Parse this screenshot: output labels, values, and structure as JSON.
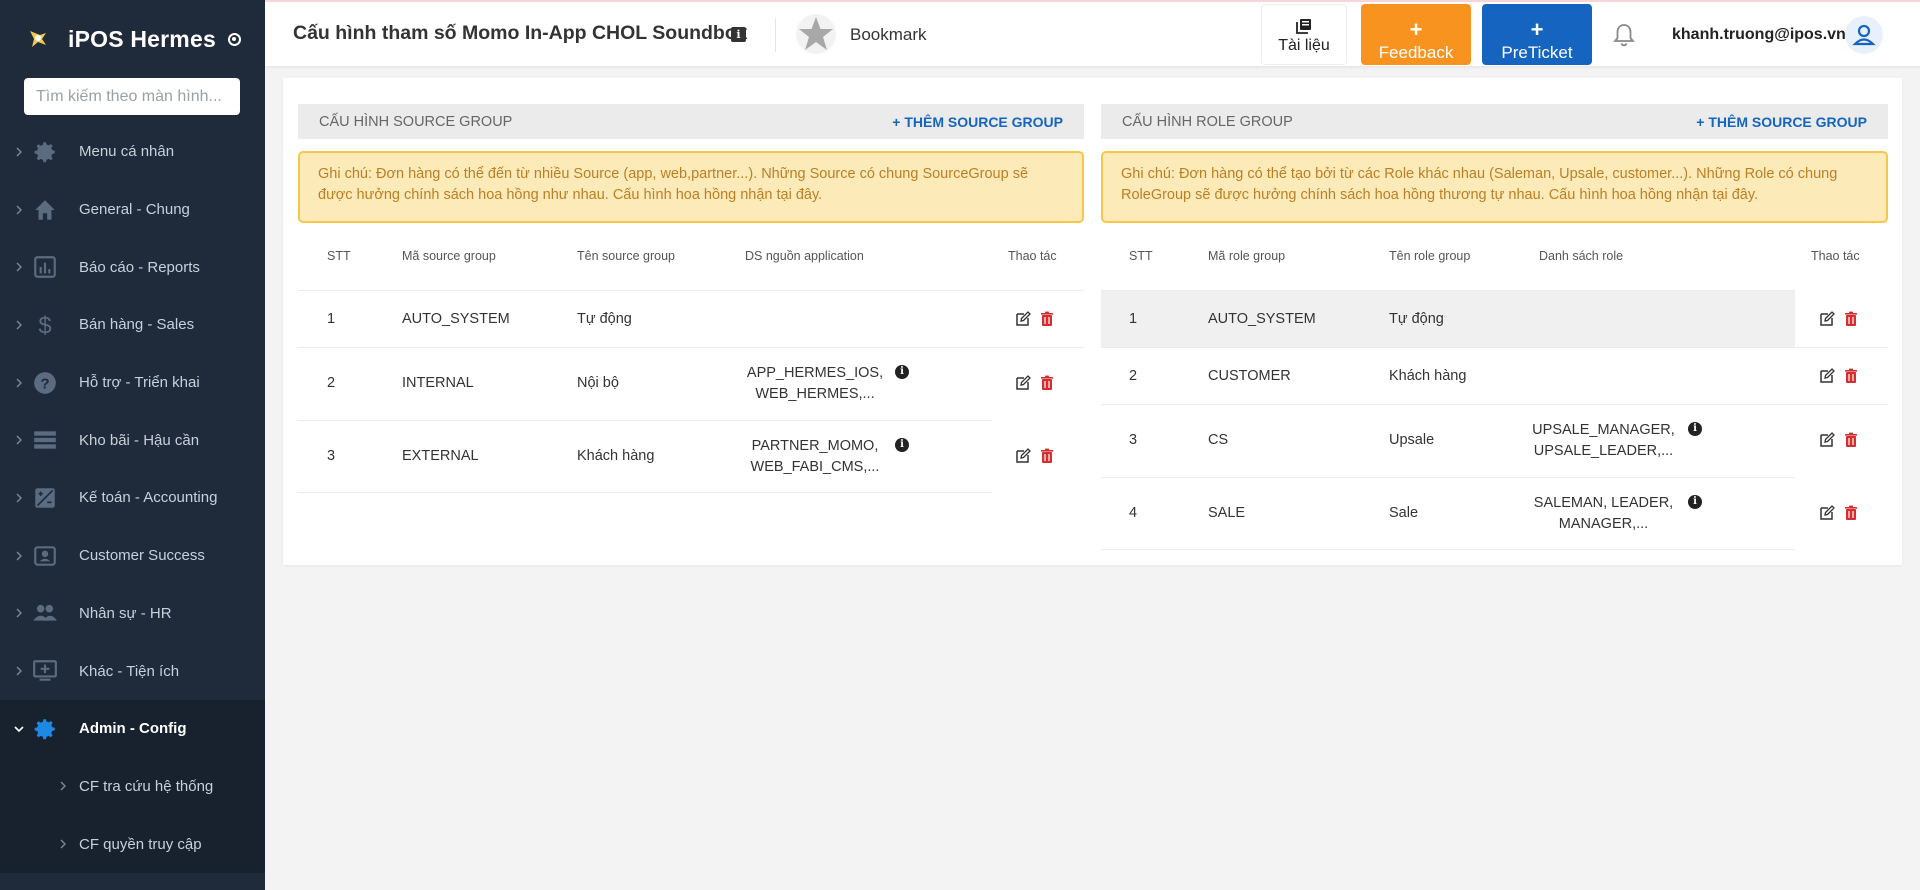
{
  "sidebar": {
    "brand": "iPOS Hermes",
    "search_placeholder": "Tìm kiếm theo màn hình...",
    "items": [
      {
        "label": "Menu cá nhân",
        "icon": "gear-icon"
      },
      {
        "label": "General - Chung",
        "icon": "home-icon"
      },
      {
        "label": "Báo cáo - Reports",
        "icon": "report-chart-icon"
      },
      {
        "label": "Bán hàng - Sales",
        "icon": "dollar-icon"
      },
      {
        "label": "Hỗ trợ - Triển khai",
        "icon": "help-circle-icon"
      },
      {
        "label": "Kho bãi - Hậu cần",
        "icon": "storage-icon"
      },
      {
        "label": "Kế toán - Accounting",
        "icon": "calculator-icon"
      },
      {
        "label": "Customer Success",
        "icon": "contact-card-icon"
      },
      {
        "label": "Nhân sự - HR",
        "icon": "people-icon"
      },
      {
        "label": "Khác - Tiện ích",
        "icon": "monitor-plus-icon"
      },
      {
        "label": "Admin - Config",
        "icon": "gear-icon"
      }
    ],
    "sub_items": [
      {
        "label": "CF tra cứu hệ thống"
      },
      {
        "label": "CF quyền truy cập"
      }
    ]
  },
  "header": {
    "title": "Cấu hình tham số Momo In-App CHOL Soundbox",
    "bookmark": "Bookmark",
    "docs": "Tài liệu",
    "feedback": "Feedback",
    "preticket": "PreTicket",
    "user_email": "khanh.truong@ipos.vn"
  },
  "source_panel": {
    "title": "CẤU HÌNH SOURCE GROUP",
    "add": "+ THÊM SOURCE GROUP",
    "note": "Ghi chú: Đơn hàng có thể đến từ nhiều Source (app, web,partner...). Những Source có chung SourceGroup sẽ được hưởng chính sách hoa hồng như nhau. Cấu hình hoa hồng nhận tại đây.",
    "columns": [
      "STT",
      "Mã source group",
      "Tên source group",
      "DS nguồn application",
      "Thao tác"
    ],
    "rows": [
      {
        "stt": "1",
        "code": "AUTO_SYSTEM",
        "name": "Tự động",
        "apps": [
          "",
          ""
        ]
      },
      {
        "stt": "2",
        "code": "INTERNAL",
        "name": "Nội bộ",
        "apps": [
          "APP_HERMES_IOS,",
          "WEB_HERMES,..."
        ]
      },
      {
        "stt": "3",
        "code": "EXTERNAL",
        "name": "Khách hàng",
        "apps": [
          "PARTNER_MOMO,",
          "WEB_FABI_CMS,..."
        ]
      }
    ]
  },
  "role_panel": {
    "title": "CẤU HÌNH ROLE GROUP",
    "add": "+ THÊM SOURCE GROUP",
    "note": "Ghi chú: Đơn hàng có thể tạo bởi từ các Role khác nhau (Saleman, Upsale, customer...). Những Role có chung RoleGroup sẽ được hưởng chính sách hoa hồng thương tự nhau. Cấu hình hoa hồng nhận tại đây.",
    "columns": [
      "STT",
      "Mã role group",
      "Tên role group",
      "Danh sách role",
      "Thao tác"
    ],
    "rows": [
      {
        "stt": "1",
        "code": "AUTO_SYSTEM",
        "name": "Tự động",
        "roles": [
          "",
          ""
        ]
      },
      {
        "stt": "2",
        "code": "CUSTOMER",
        "name": "Khách hàng",
        "roles": [
          "",
          ""
        ]
      },
      {
        "stt": "3",
        "code": "CS",
        "name": "Upsale",
        "roles": [
          "UPSALE_MANAGER,",
          "UPSALE_LEADER,..."
        ]
      },
      {
        "stt": "4",
        "code": "SALE",
        "name": "Sale",
        "roles": [
          "SALEMAN, LEADER,",
          "MANAGER,..."
        ]
      }
    ]
  },
  "colors": {
    "sidebar_bg": "#1f2a3a",
    "accent_blue": "#1565c0",
    "feedback_orange": "#f7931e",
    "note_bg": "#fdeab9",
    "delete_red": "#d32f2f"
  }
}
